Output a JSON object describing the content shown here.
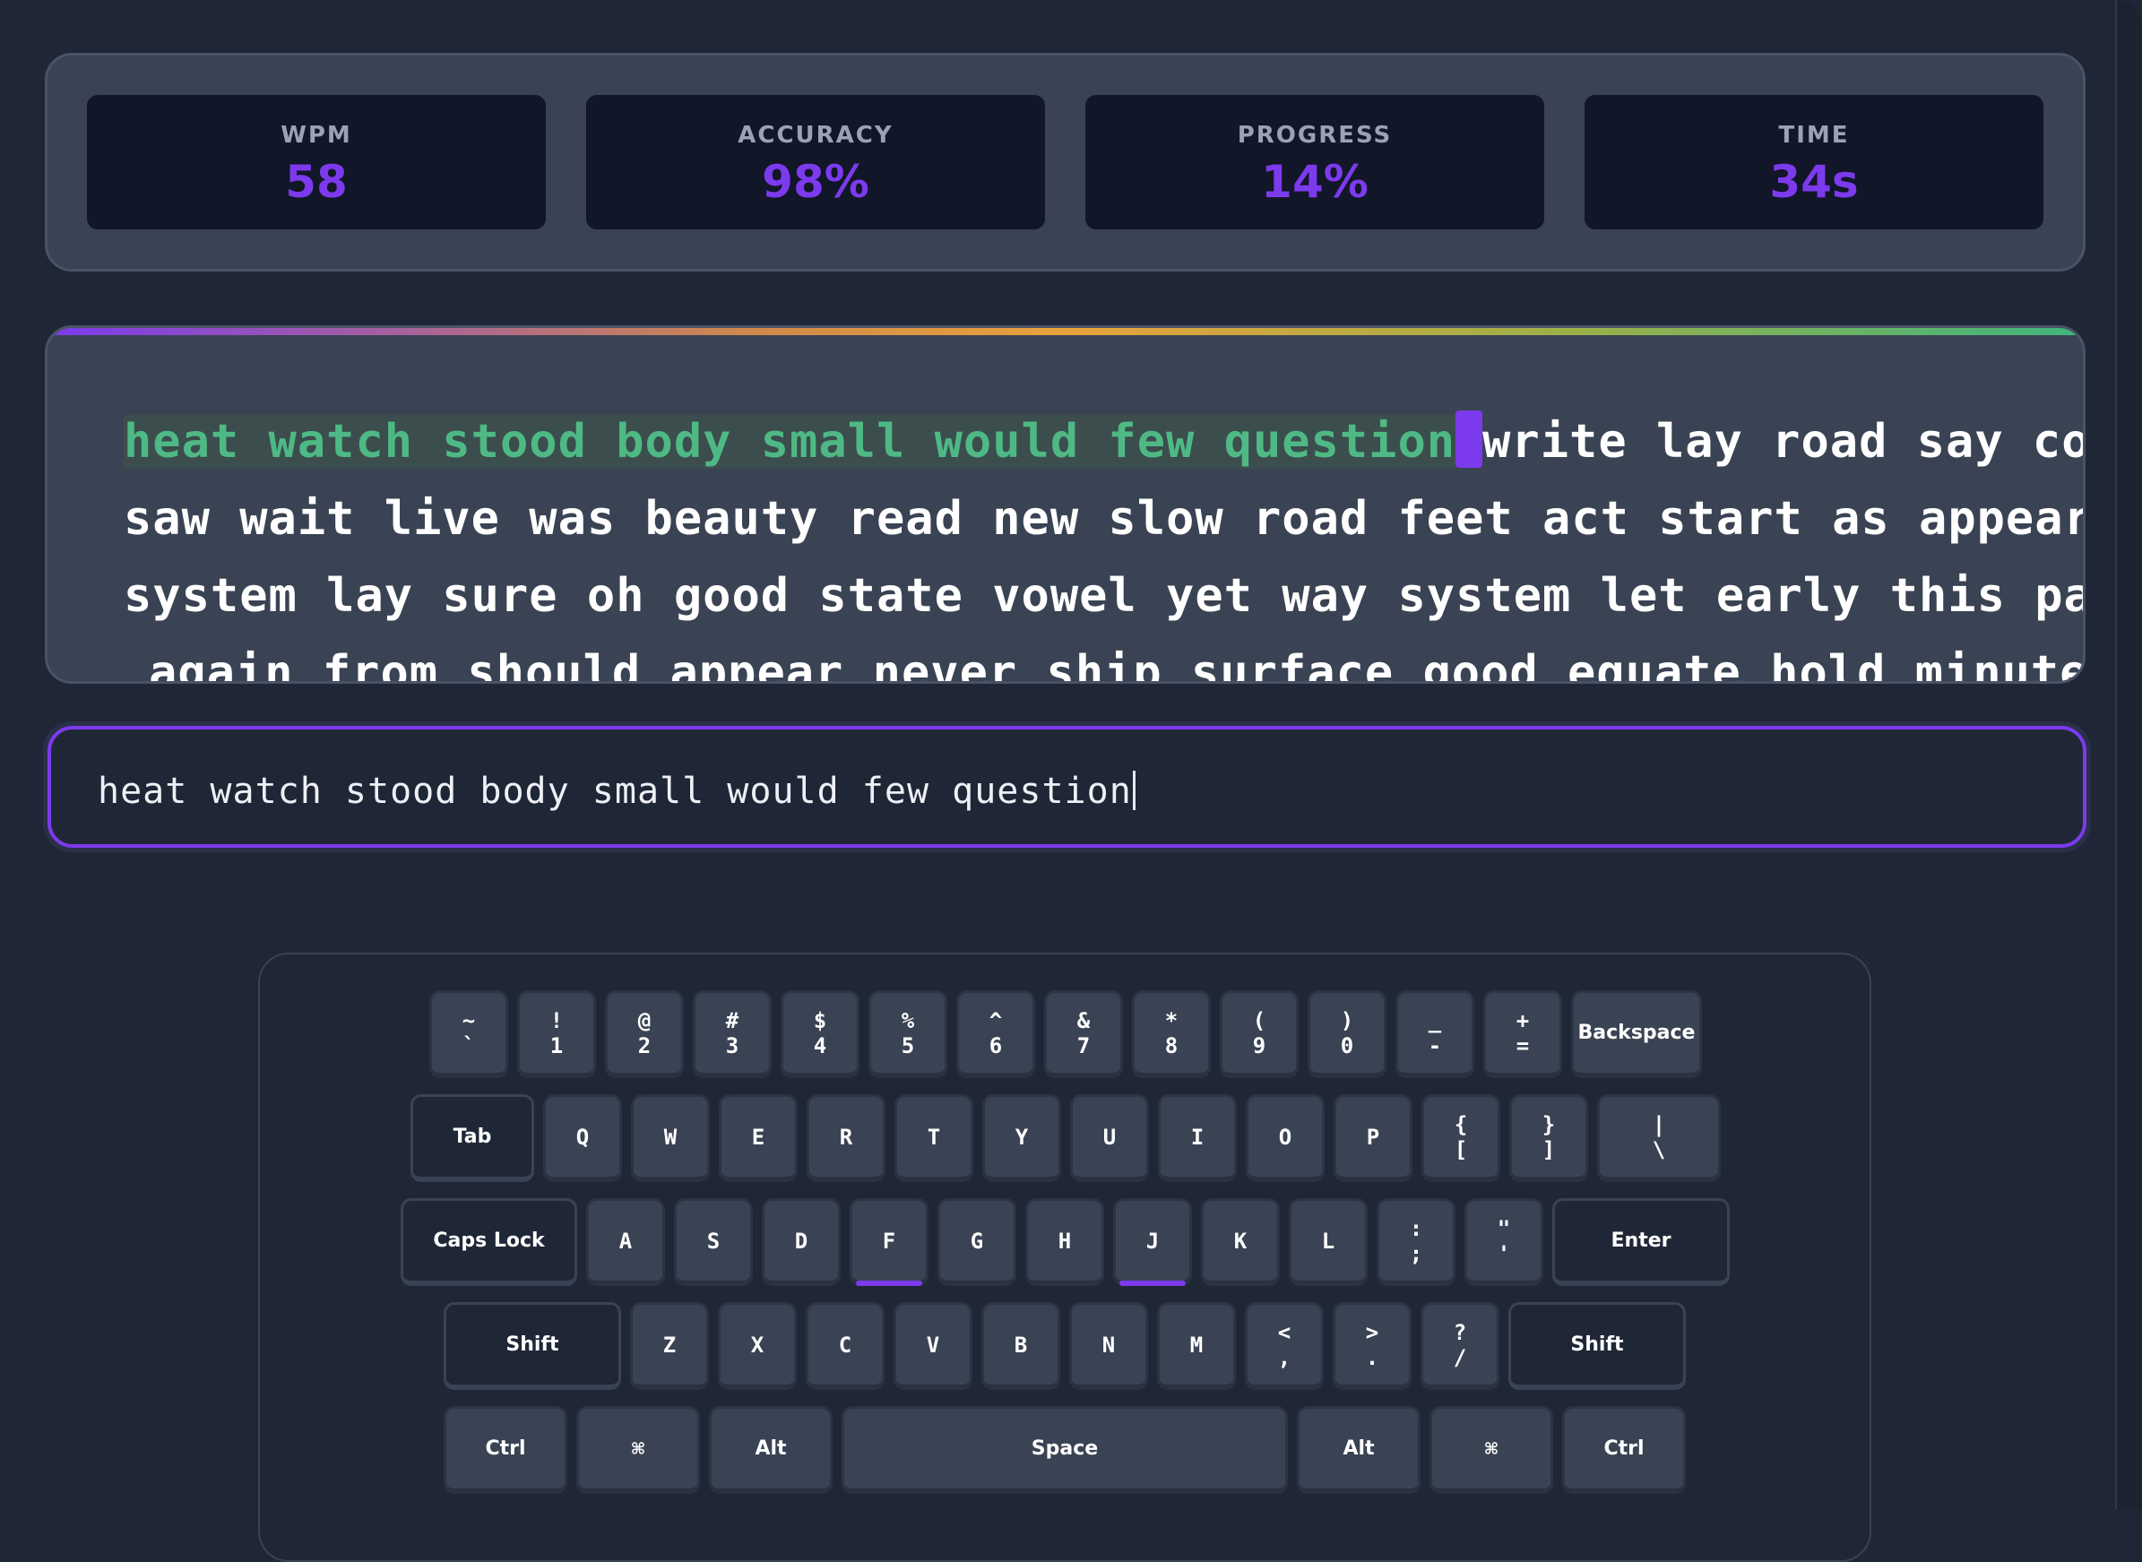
{
  "stats": [
    {
      "label": "WPM",
      "value": "58"
    },
    {
      "label": "ACCURACY",
      "value": "98%"
    },
    {
      "label": "PROGRESS",
      "value": "14%"
    },
    {
      "label": "TIME",
      "value": "34s"
    }
  ],
  "passage": {
    "typed": "heat watch stood body small would few question",
    "line1_rest": "write lay road say course",
    "line2": "saw wait live was beauty read new slow road feet act start as appear",
    "line3": "system lay sure oh good state vowel yet way system let early this pattern",
    "line4": "again from should appear never ship surface good equate hold minute fill"
  },
  "input": {
    "value": "heat watch stood body small would few question"
  },
  "keyboard": {
    "row1": [
      {
        "top": "~",
        "bottom": "`"
      },
      {
        "top": "!",
        "bottom": "1"
      },
      {
        "top": "@",
        "bottom": "2"
      },
      {
        "top": "#",
        "bottom": "3"
      },
      {
        "top": "$",
        "bottom": "4"
      },
      {
        "top": "%",
        "bottom": "5"
      },
      {
        "top": "^",
        "bottom": "6"
      },
      {
        "top": "&",
        "bottom": "7"
      },
      {
        "top": "*",
        "bottom": "8"
      },
      {
        "top": "(",
        "bottom": "9"
      },
      {
        "top": ")",
        "bottom": "0"
      },
      {
        "top": "_",
        "bottom": "-"
      },
      {
        "top": "+",
        "bottom": "="
      }
    ],
    "backspace": "Backspace",
    "tab": "Tab",
    "row2": [
      "Q",
      "W",
      "E",
      "R",
      "T",
      "Y",
      "U",
      "I",
      "O",
      "P"
    ],
    "row2_sym": [
      {
        "top": "{",
        "bottom": "["
      },
      {
        "top": "}",
        "bottom": "]"
      },
      {
        "top": "|",
        "bottom": "\\"
      }
    ],
    "capslock": "Caps Lock",
    "row3": [
      "A",
      "S",
      "D",
      "F",
      "G",
      "H",
      "J",
      "K",
      "L"
    ],
    "row3_sym": [
      {
        "top": ":",
        "bottom": ";"
      },
      {
        "top": "\"",
        "bottom": "'"
      }
    ],
    "enter": "Enter",
    "shift_left": "Shift",
    "row4": [
      "Z",
      "X",
      "C",
      "V",
      "B",
      "N",
      "M"
    ],
    "row4_sym": [
      {
        "top": "<",
        "bottom": ","
      },
      {
        "top": ">",
        "bottom": "."
      },
      {
        "top": "?",
        "bottom": "/"
      }
    ],
    "shift_right": "Shift",
    "ctrl_left": "Ctrl",
    "cmd_left": "⌘",
    "alt_left": "Alt",
    "space": "Space",
    "alt_right": "Alt",
    "cmd_right": "⌘",
    "ctrl_right": "Ctrl"
  },
  "colors": {
    "accent": "#7c3aed",
    "typed_text": "#4fb985"
  }
}
